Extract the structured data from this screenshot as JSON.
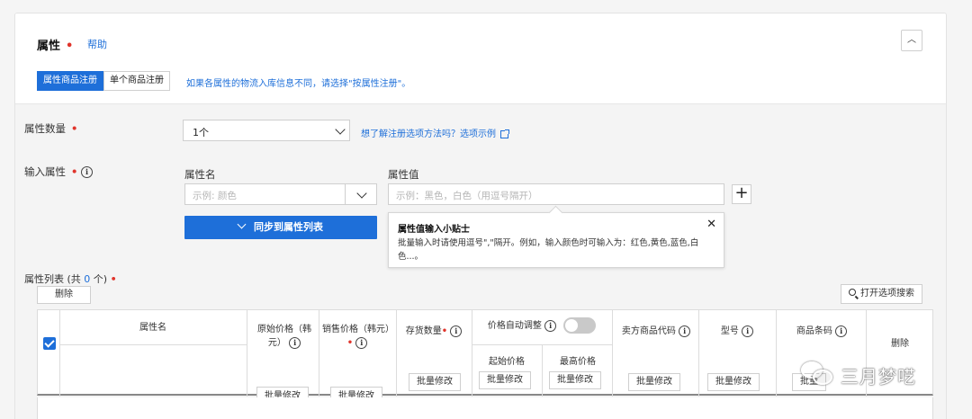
{
  "header": {
    "title": "属性",
    "help": "帮助",
    "collapse_icon": "chevron-up-icon"
  },
  "mode": {
    "tabs": [
      "属性商品注册",
      "单个商品注册"
    ],
    "active": 0,
    "note": "如果各属性的物流入库信息不同，请选择\"按属性注册\"。"
  },
  "count": {
    "label": "属性数量",
    "value": "1个",
    "help_text": "想了解注册选项方法吗？选项示例"
  },
  "input_attr": {
    "label": "输入属性",
    "name_label": "属性名",
    "name_placeholder": "示例: 颜色",
    "value_label": "属性值",
    "value_placeholder": "示例：黑色，白色（用逗号隔开）",
    "add": "+",
    "sync_button": "同步到属性列表"
  },
  "tooltip": {
    "title": "属性值输入小贴士",
    "close": "✕",
    "text": "批量输入时请使用逗号\",\"隔开。例如，输入颜色时可输入为：红色,黄色,蓝色,白色...。"
  },
  "list": {
    "label_prefix": "属性列表 (共 ",
    "count": "0",
    "label_suffix": " 个)",
    "delete": "删除",
    "search": "打开选项搜索"
  },
  "table": {
    "headers": {
      "attr_name": "属性名",
      "orig_price": "原始价格（韩元）",
      "sale_price": "销售价格（韩元）",
      "stock": "存货数量",
      "auto_price": "价格自动调整",
      "start_price": "起始价格",
      "max_price": "最高价格",
      "seller_code": "卖方商品代码",
      "model": "型号",
      "barcode": "商品条码",
      "delete": "删除"
    },
    "bulk_edit": "批量修改"
  },
  "watermark": "三月梦呓"
}
